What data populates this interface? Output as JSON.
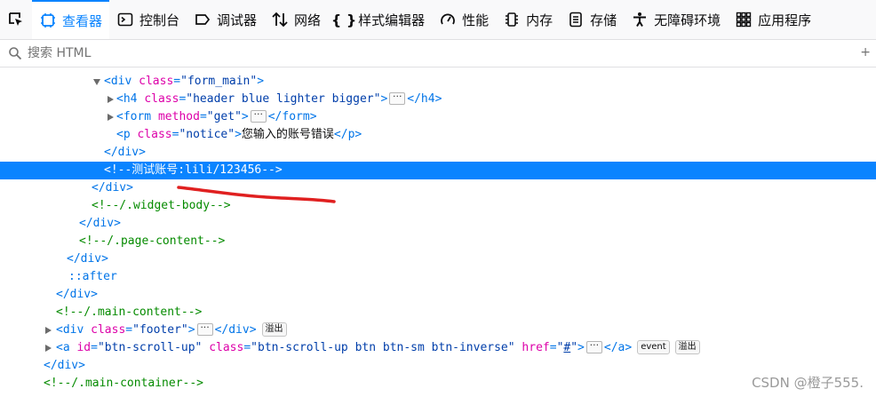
{
  "toolbar": {
    "tabs": [
      {
        "label": "查看器",
        "icon": "inspector-icon",
        "selected": true
      },
      {
        "label": "控制台",
        "icon": "console-icon"
      },
      {
        "label": "调试器",
        "icon": "debugger-icon"
      },
      {
        "label": "网络",
        "icon": "network-icon"
      },
      {
        "label": "样式编辑器",
        "icon": "style-editor-icon"
      },
      {
        "label": "性能",
        "icon": "performance-icon"
      },
      {
        "label": "内存",
        "icon": "memory-icon"
      },
      {
        "label": "存储",
        "icon": "storage-icon"
      },
      {
        "label": "无障碍环境",
        "icon": "accessibility-icon"
      },
      {
        "label": "应用程序",
        "icon": "application-icon"
      }
    ]
  },
  "search": {
    "placeholder": "搜索 HTML"
  },
  "tree": {
    "r1": {
      "tag": "div",
      "attr": "class",
      "val": "form_main"
    },
    "r2": {
      "tag": "h4",
      "attr": "class",
      "val": "header blue lighter bigger"
    },
    "r3": {
      "tag": "form",
      "attr": "method",
      "val": "get"
    },
    "r4": {
      "tag": "p",
      "attr": "class",
      "val": "notice",
      "text": "您输入的账号错误"
    },
    "r5": {
      "tag": "div"
    },
    "r6": {
      "comment": "<!--测试账号:lili/123456-->"
    },
    "r7": {
      "tag": "div"
    },
    "r8": {
      "comment": "<!--/.widget-body-->"
    },
    "r9": {
      "tag": "div"
    },
    "r10": {
      "comment": "<!--/.page-content-->"
    },
    "r11": {
      "tag": "div"
    },
    "r12": {
      "pseudo": "::after"
    },
    "r13": {
      "tag": "div"
    },
    "r14": {
      "comment": "<!--/.main-content-->"
    },
    "r15": {
      "tag": "div",
      "attr": "class",
      "val": "footer",
      "badge": "溢出"
    },
    "r16": {
      "tag": "a",
      "a1": "id",
      "v1": "btn-scroll-up",
      "a2": "class",
      "v2": "btn-scroll-up btn btn-sm btn-inverse",
      "a3": "href",
      "v3": "#",
      "badge1": "event",
      "badge2": "溢出"
    },
    "r17": {
      "tag": "div"
    },
    "r18": {
      "comment": "<!--/.main-container-->"
    }
  },
  "watermark": "CSDN @橙子555."
}
